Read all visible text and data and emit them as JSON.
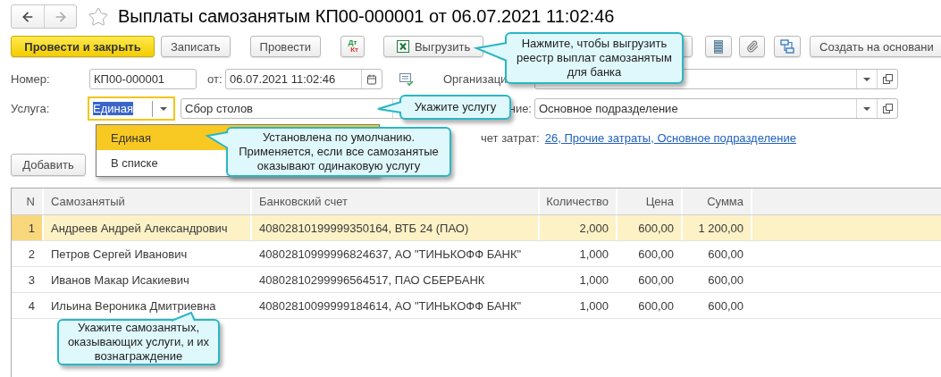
{
  "window": {
    "title": "Выплаты самозанятым КП00-000001 от 06.07.2021 11:02:46",
    "favorite": false
  },
  "nav": {
    "back_enabled": true,
    "forward_enabled": false
  },
  "toolbar": [
    {
      "kind": "primary",
      "label": "Провести и закрыть"
    },
    {
      "kind": "text",
      "label": "Записать"
    },
    {
      "kind": "text",
      "label": "Провести"
    },
    {
      "kind": "dtkt",
      "top": "Дт",
      "bottom": "Кт"
    },
    {
      "kind": "excel",
      "label": "Выгрузить"
    },
    {
      "kind": "covered"
    },
    {
      "kind": "report"
    },
    {
      "kind": "attach"
    },
    {
      "kind": "structure"
    },
    {
      "kind": "text",
      "label": "Создать на основани"
    }
  ],
  "number": {
    "label": "Номер:",
    "value": "КП00-000001"
  },
  "date": {
    "label": "от:",
    "value": "06.07.2021 11:02:46"
  },
  "organization": {
    "label": "Организаци"
  },
  "service": {
    "label": "Услуга:",
    "mode": "Единая",
    "focused": true,
    "value": "Сбор столов"
  },
  "department": {
    "label": "ние:",
    "value": "Основное подразделение"
  },
  "cost": {
    "label": "чет затрат:",
    "link": "26, Прочие затраты, Основное подразделение"
  },
  "service_dropdown": [
    {
      "label": "Единая",
      "selected": true
    },
    {
      "label": "В списке",
      "selected": false
    }
  ],
  "add_button": "Добавить",
  "table": {
    "columns": [
      "N",
      "Самозанятый",
      "Банковский счет",
      "Количество",
      "Цена",
      "Сумма"
    ],
    "rows": [
      {
        "n": "1",
        "name": "Андреев Андрей Александрович",
        "account": "40802810199999350164, ВТБ 24 (ПАО)",
        "qty": "2,000",
        "price": "600,00",
        "sum": "1 200,00",
        "selected": true
      },
      {
        "n": "2",
        "name": "Петров Сергей Иванович",
        "account": "40802810999996824637, АО \"ТИНЬКОФФ БАНК\"",
        "qty": "1,000",
        "price": "600,00",
        "sum": "600,00",
        "selected": false
      },
      {
        "n": "3",
        "name": "Иванов Макар Исакиевич",
        "account": "40802810299996564517, ПАО СБЕРБАНК",
        "qty": "1,000",
        "price": "600,00",
        "sum": "600,00",
        "selected": false
      },
      {
        "n": "4",
        "name": "Ильина Вероника Дмитриевна",
        "account": "40802810099999184614, АО \"ТИНЬКОФФ БАНК\"",
        "qty": "1,000",
        "price": "600,00",
        "sum": "600,00",
        "selected": false
      }
    ]
  },
  "callouts": [
    {
      "text": "Нажмите, чтобы выгрузить реестр выплат самозанятым для банка"
    },
    {
      "text": "Укажите услугу"
    },
    {
      "text": "Установлена по умолчанию. Применяется, если все самозанятые оказывают одинаковую услугу"
    },
    {
      "text": "Укажите самозанятых, оказывающих услуги, и их вознаграждение"
    }
  ]
}
